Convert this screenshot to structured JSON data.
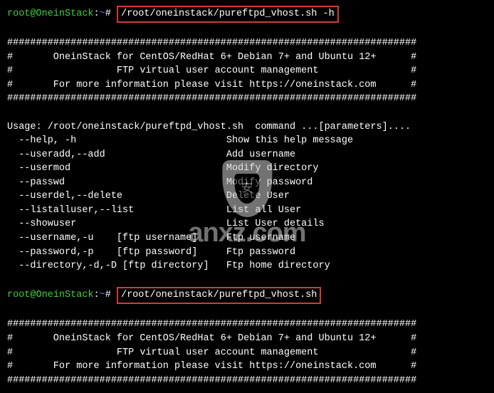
{
  "prompt": {
    "user": "root",
    "host": "OneinStack",
    "path": "~",
    "symbol": "#"
  },
  "cmd1": "/root/oneinstack/pureftpd_vhost.sh -h",
  "cmd2": "/root/oneinstack/pureftpd_vhost.sh",
  "banner_border": "#######################################################################",
  "banner_line1": "#       OneinStack for CentOS/RedHat 6+ Debian 7+ and Ubuntu 12+      #",
  "banner_line2": "#                  FTP virtual user account management                #",
  "banner_line3": "#       For more information please visit https://oneinstack.com      #",
  "usage_header": "Usage: /root/oneinstack/pureftpd_vhost.sh  command ...[parameters]....",
  "opts": [
    {
      "flag": "  --help, -h                          ",
      "desc": "Show this help message"
    },
    {
      "flag": "  --useradd,--add                     ",
      "desc": "Add username"
    },
    {
      "flag": "  --usermod                           ",
      "desc": "Modify directory"
    },
    {
      "flag": "  --passwd                            ",
      "desc": "Modify password"
    },
    {
      "flag": "  --userdel,--delete                  ",
      "desc": "Delete User"
    },
    {
      "flag": "  --listalluser,--list                ",
      "desc": "List all User"
    },
    {
      "flag": "  --showuser                          ",
      "desc": "List User details"
    },
    {
      "flag": "  --username,-u    [ftp username]     ",
      "desc": "Ftp username"
    },
    {
      "flag": "  --password,-p    [ftp password]     ",
      "desc": "Ftp password"
    },
    {
      "flag": "  --directory,-d,-D [ftp directory]   ",
      "desc": "Ftp home directory"
    }
  ],
  "watermark": {
    "shield_char": "安",
    "text": "anxz.com"
  }
}
